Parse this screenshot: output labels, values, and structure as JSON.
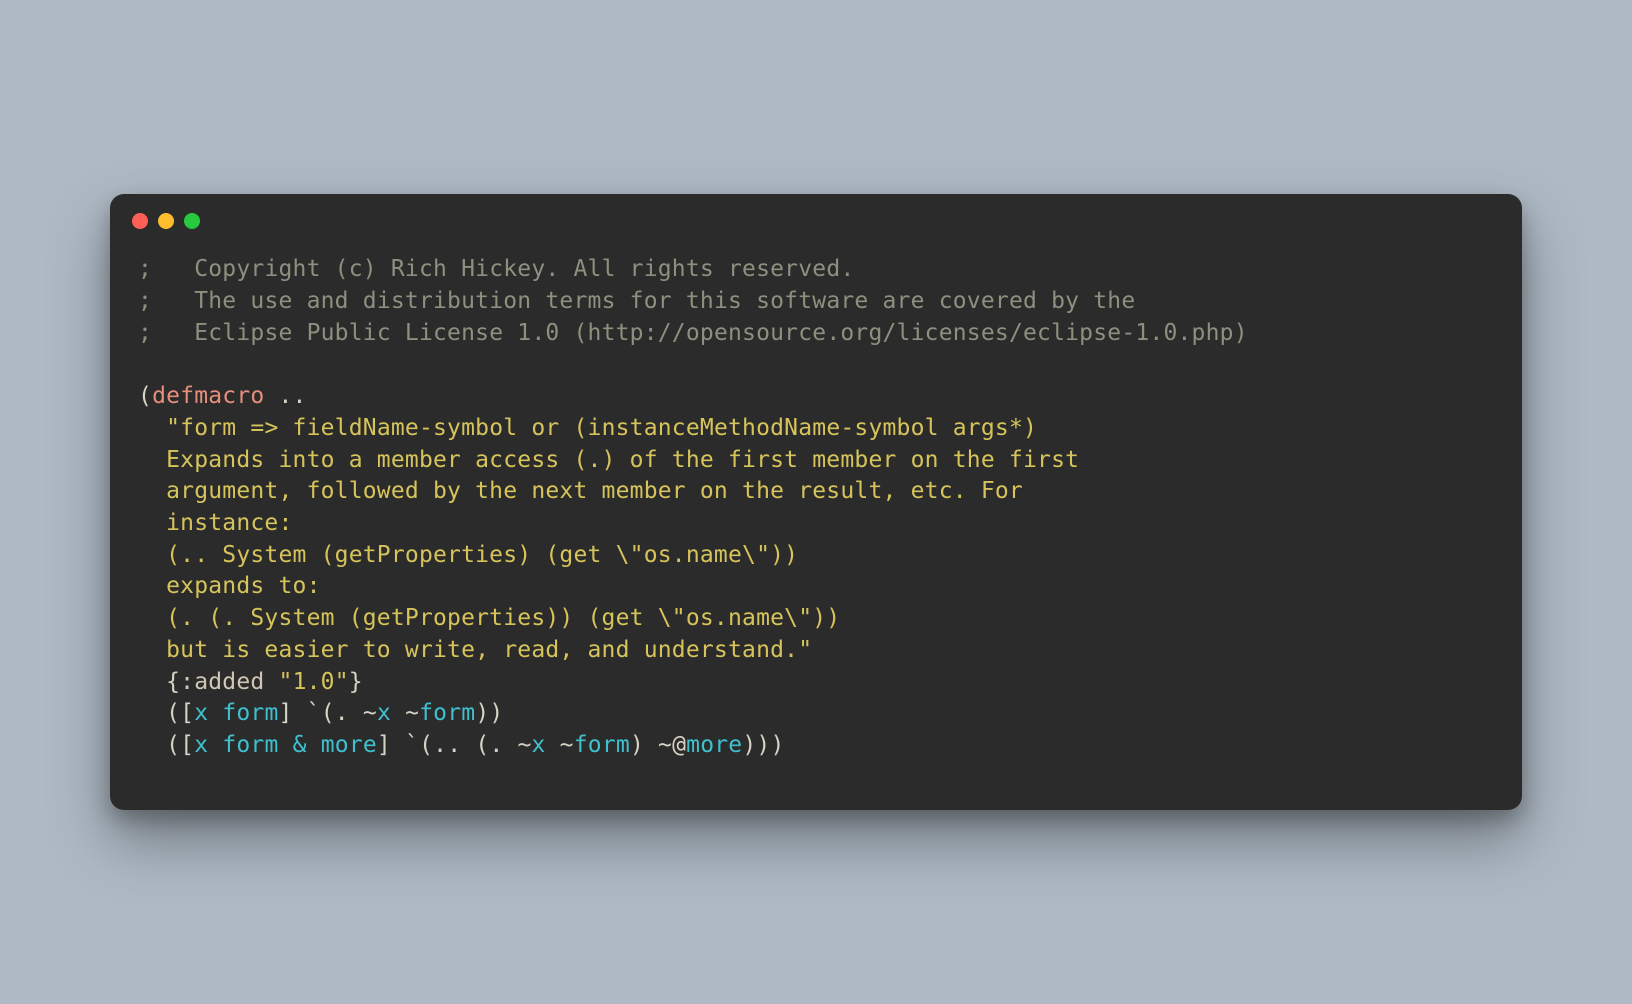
{
  "window": {
    "traffic_lights": [
      "close",
      "minimize",
      "zoom"
    ]
  },
  "code": {
    "comment_prefix": ";   ",
    "comment_lines": [
      "Copyright (c) Rich Hickey. All rights reserved.",
      "The use and distribution terms for this software are covered by the",
      "Eclipse Public License 1.0 (http://opensource.org/licenses/eclipse-1.0.php)"
    ],
    "open_paren": "(",
    "defmacro": "defmacro",
    "macro_name": " ..",
    "docstring_open": "  \"",
    "docstring_lines": [
      "form => fieldName-symbol or (instanceMethodName-symbol args*)",
      "  Expands into a member access (.) of the first member on the first",
      "  argument, followed by the next member on the result, etc. For",
      "  instance:",
      "  (.. System (getProperties) (get \\\"os.name\\\"))",
      "  expands to:",
      "  (. (. System (getProperties)) (get \\\"os.name\\\"))",
      "  but is easier to write, read, and understand.\""
    ],
    "meta_open": "  {",
    "meta_key": ":added",
    "meta_sp": " ",
    "meta_val": "\"1.0\"",
    "meta_close": "}",
    "arity1": {
      "lead": "  ([",
      "x": "x",
      "sp1": " ",
      "form": "form",
      "close_vec": "] ",
      "bt": "`",
      "open": "(",
      "dot": ". ",
      "ux": "~",
      "xv": "x",
      "sp2": " ",
      "uf": "~",
      "fv": "form",
      "close": "))"
    },
    "arity2": {
      "lead": "  ([",
      "x": "x",
      "sp1": " ",
      "form": "form",
      "sp2": " ",
      "amp": "&",
      "sp3": " ",
      "more": "more",
      "close_vec": "] ",
      "bt": "`",
      "open": "(",
      "dd": ".. ",
      "open2": "(",
      "dot": ". ",
      "ux": "~",
      "xv": "x",
      "sp4": " ",
      "uf": "~",
      "fv": "form",
      "close2": ") ",
      "usp": "~@",
      "morev": "more",
      "close": ")))"
    }
  }
}
